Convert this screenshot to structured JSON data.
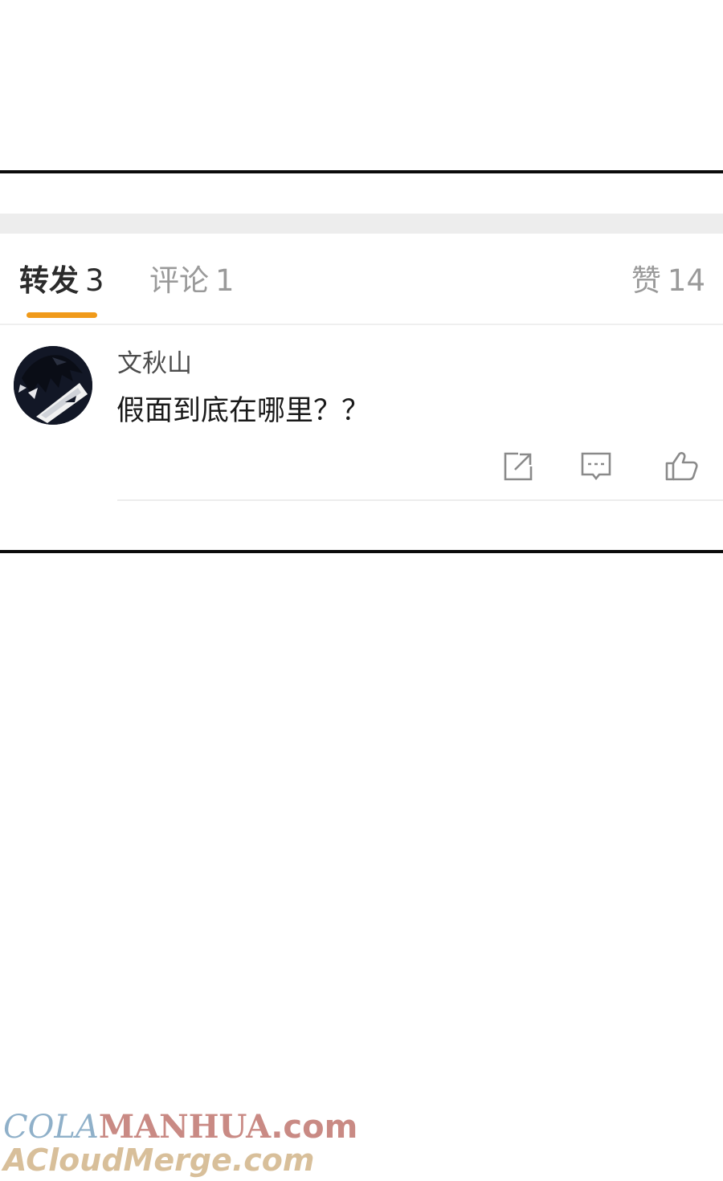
{
  "tabs": [
    {
      "label": "转发",
      "count": "3",
      "active": true
    },
    {
      "label": "评论",
      "count": "1",
      "active": false
    }
  ],
  "likes": {
    "label": "赞",
    "count": "14"
  },
  "comment": {
    "username": "文秋山",
    "text": "假面到底在哪里？？"
  },
  "actions": {
    "share_icon": "share-icon",
    "reply_icon": "comment-bubble-icon",
    "like_icon": "thumbs-up-icon"
  },
  "colors": {
    "accent": "#f09a1a",
    "tab_inactive": "#9a9a9a",
    "frame_line": "#0b0b0b"
  },
  "watermark": {
    "line1_part1": "COLA",
    "line1_part2": "MANHUA",
    "line1_part3": ".com",
    "line2": "ACloudMerge.com"
  }
}
